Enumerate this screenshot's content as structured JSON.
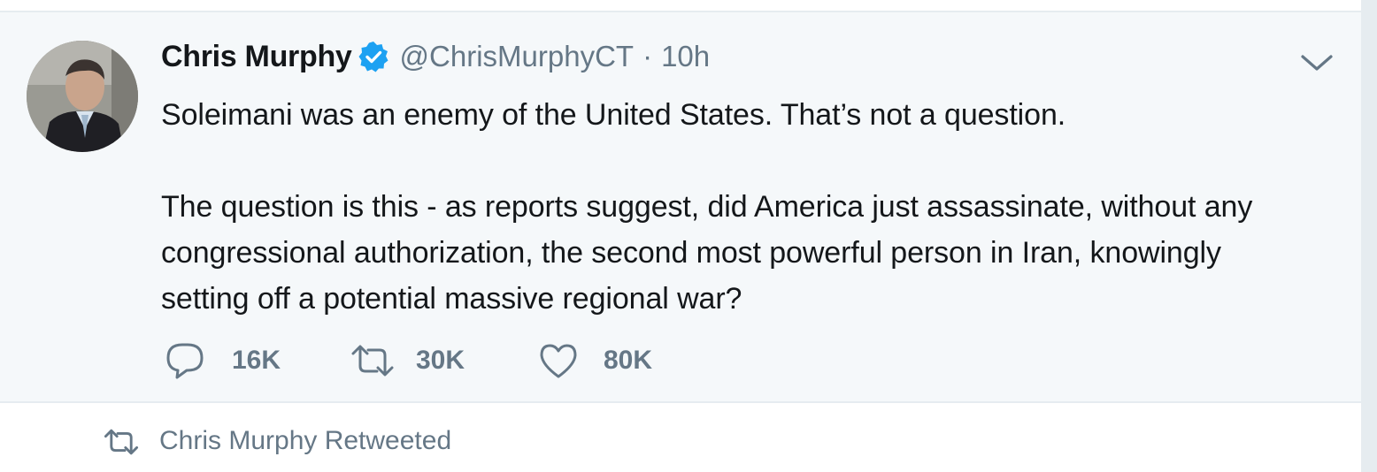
{
  "tweet": {
    "author_name": "Chris Murphy",
    "handle": "@ChrisMurphyCT",
    "separator": "·",
    "timestamp": "10h",
    "verified": true,
    "text_paragraph_1": "Soleimani was an enemy of the United States. That’s not a question.",
    "text_paragraph_2": "The question is this - as reports suggest, did America just assassinate, without any congressional authorization, the second most powerful person in Iran, knowingly setting off a potential massive regional war?",
    "actions": {
      "reply_count": "16K",
      "retweet_count": "30K",
      "like_count": "80K"
    }
  },
  "next_item": {
    "retweeted_label": "Chris Murphy Retweeted"
  },
  "colors": {
    "card_background": "#f5f8fa",
    "text_primary": "#14171a",
    "text_secondary": "#657786",
    "verified_blue": "#1da1f2",
    "divider": "#e6ecf0"
  },
  "icons": {
    "verified": "verified-badge-icon",
    "caret": "chevron-down-icon",
    "reply": "reply-icon",
    "retweet": "retweet-icon",
    "like": "heart-icon"
  }
}
